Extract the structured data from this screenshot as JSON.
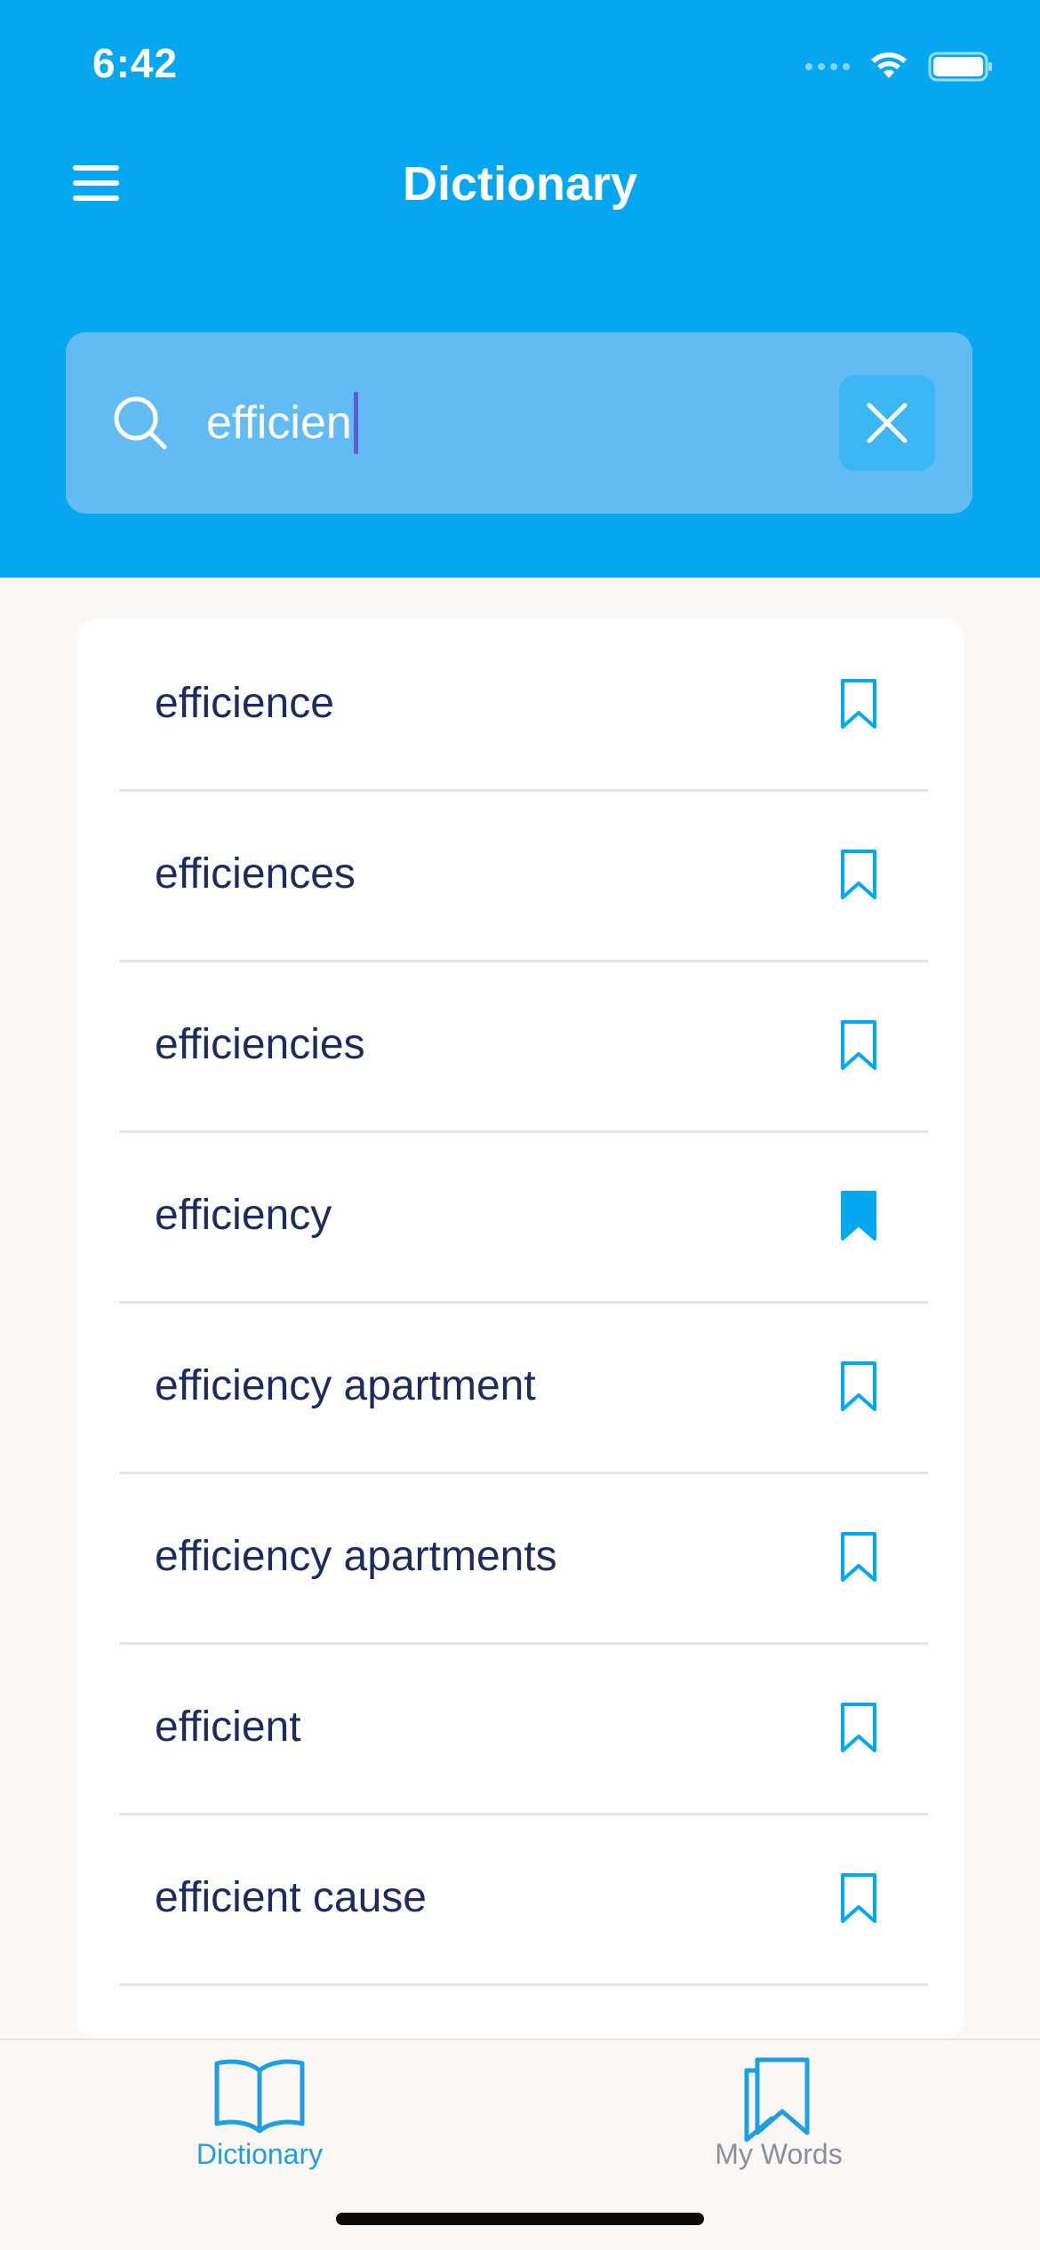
{
  "status_bar": {
    "time": "6:42"
  },
  "header": {
    "title": "Dictionary",
    "background_color": "#05a7f1"
  },
  "search": {
    "value": "efficien",
    "clear_icon": "close-icon",
    "search_icon": "search-icon"
  },
  "results": [
    {
      "word": "efficience",
      "bookmarked": false
    },
    {
      "word": "efficiences",
      "bookmarked": false
    },
    {
      "word": "efficiencies",
      "bookmarked": false
    },
    {
      "word": "efficiency",
      "bookmarked": true
    },
    {
      "word": "efficiency apartment",
      "bookmarked": false
    },
    {
      "word": "efficiency apartments",
      "bookmarked": false
    },
    {
      "word": "efficient",
      "bookmarked": false
    },
    {
      "word": "efficient cause",
      "bookmarked": false
    }
  ],
  "tab_bar": {
    "tabs": [
      {
        "label": "Dictionary",
        "icon": "open-book-icon",
        "active": true
      },
      {
        "label": "My Words",
        "icon": "bookmarks-icon",
        "active": false
      }
    ]
  },
  "colors": {
    "accent": "#05a7f1",
    "text_primary": "#1f2b5c",
    "tab_inactive": "#8a8f9c"
  }
}
